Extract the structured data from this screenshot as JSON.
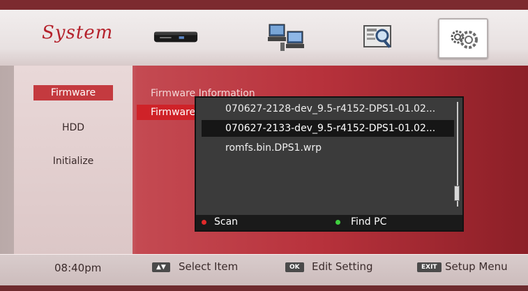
{
  "header": {
    "title": "System",
    "tabs": [
      {
        "name": "settop-box-icon"
      },
      {
        "name": "network-pcs-icon"
      },
      {
        "name": "info-screen-icon"
      },
      {
        "name": "gears-icon"
      }
    ]
  },
  "sidebar": {
    "items": [
      {
        "label": "Firmware"
      },
      {
        "label": "HDD"
      },
      {
        "label": "Initialize"
      }
    ]
  },
  "main": {
    "firmware_info_label": "Firmware Information",
    "firmware_update_label": "Firmware"
  },
  "popup": {
    "files": [
      "070627-2128-dev_9.5-r4152-DPS1-01.02...",
      "070627-2133-dev_9.5-r4152-DPS1-01.02...",
      "romfs.bin.DPS1.wrp"
    ],
    "scan_label": "Scan",
    "find_pc_label": "Find PC"
  },
  "footer": {
    "time": "08:40pm",
    "arrows_key": "▲▼",
    "select_hint": "Select Item",
    "ok_key": "OK",
    "edit_hint": "Edit Setting",
    "exit_key": "EXIT",
    "setup_hint": "Setup Menu"
  },
  "colors": {
    "accent_red": "#cf2228",
    "popup_bg": "#3b3b3b"
  }
}
